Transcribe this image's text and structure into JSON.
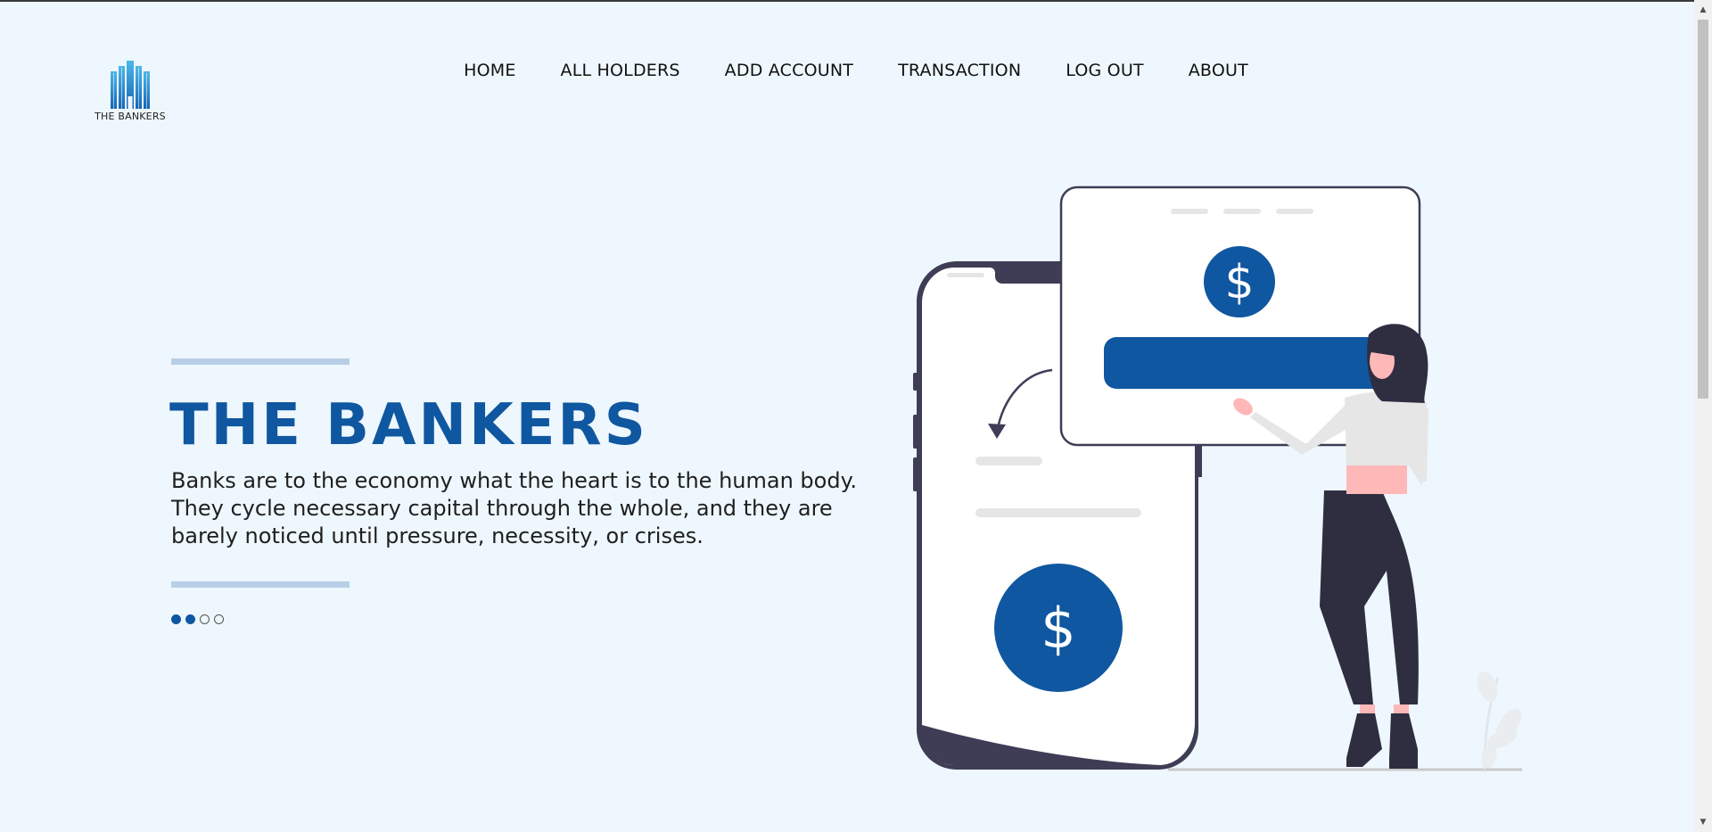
{
  "brand": {
    "logo_text": "THE BANKERS",
    "accent_color": "#0f57a0",
    "background_color": "#eef7fd"
  },
  "nav": {
    "items": [
      {
        "label": "HOME"
      },
      {
        "label": "ALL HOLDERS"
      },
      {
        "label": "ADD ACCOUNT"
      },
      {
        "label": "TRANSACTION"
      },
      {
        "label": "LOG OUT"
      },
      {
        "label": "ABOUT"
      }
    ]
  },
  "hero": {
    "title": "THE BANKERS",
    "description": "Banks are to the economy what the heart is to the human body. They cycle necessary capital through the whole, and they are barely noticed until pressure, necessity, or crises.",
    "slider": {
      "total": 4,
      "filled": [
        true,
        true,
        false,
        false
      ]
    }
  },
  "illustration": {
    "icons": [
      "phone-icon",
      "dollar-icon",
      "card-icon",
      "person-icon",
      "plant-icon"
    ],
    "dollar_symbol": "$"
  },
  "scrollbar": {
    "up_arrow": "▲",
    "down_arrow": "▼"
  }
}
